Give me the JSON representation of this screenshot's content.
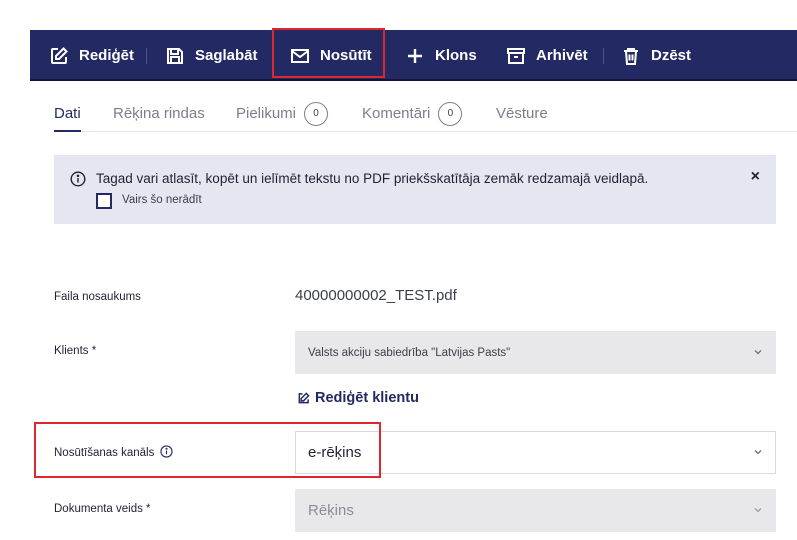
{
  "toolbar": {
    "edit": "Rediģēt",
    "save": "Saglabāt",
    "send": "Nosūtīt",
    "clone": "Klons",
    "archive": "Arhivēt",
    "delete": "Dzēst"
  },
  "tabs": [
    {
      "label": "Dati",
      "active": true
    },
    {
      "label": "Rēķina rindas"
    },
    {
      "label": "Pielikumi",
      "count": "0"
    },
    {
      "label": "Komentāri",
      "count": "0"
    },
    {
      "label": "Vēsture"
    }
  ],
  "info": {
    "message": "Tagad vari atlasīt, kopēt un ielīmēt tekstu no PDF priekšskatītāja zemāk redzamajā veidlapā.",
    "checkbox_label": "Vairs šo nerādīt",
    "close": "×"
  },
  "form": {
    "file_name_label": "Faila nosaukums",
    "file_name_value": "40000000002_TEST.pdf",
    "client_label": "Klients *",
    "client_value": "Valsts akciju sabiedrība \"Latvijas Pasts\"",
    "edit_client_label": "Rediģēt klientu",
    "channel_label": "Nosūtīšanas kanāls",
    "channel_value": "e-rēķins",
    "doc_type_label": "Dokumenta veids *",
    "doc_type_value": "Rēķins"
  },
  "colors": {
    "toolbar_bg": "#232a63",
    "highlight": "#e0262d",
    "info_bg": "#e5e6f0"
  }
}
